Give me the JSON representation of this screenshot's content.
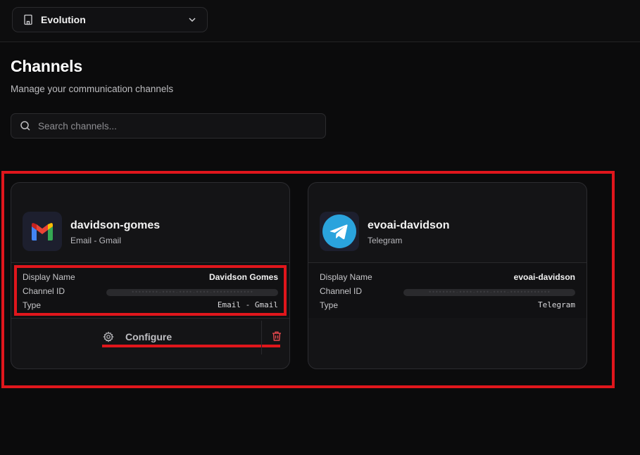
{
  "org_selector": {
    "name": "Evolution"
  },
  "page": {
    "title": "Channels",
    "subtitle": "Manage your communication channels"
  },
  "search": {
    "placeholder": "Search channels..."
  },
  "labels": {
    "display_name": "Display Name",
    "channel_id": "Channel ID",
    "type": "Type",
    "configure": "Configure"
  },
  "channels": [
    {
      "name": "davidson-gomes",
      "type_label": "Email - Gmail",
      "display_name": "Davidson Gomes",
      "channel_id": "••••••••-••••-••••-••••-••••••••••••",
      "type": "Email - Gmail",
      "icon": "gmail-icon"
    },
    {
      "name": "evoai-davidson",
      "type_label": "Telegram",
      "display_name": "evoai-davidson",
      "channel_id": "••••••••-••••-••••-••••-••••••••••••",
      "type": "Telegram",
      "icon": "telegram-icon"
    }
  ],
  "colors": {
    "highlight": "#e0161c",
    "background": "#0b0b0c",
    "card": "#141416",
    "telegram": "#2aa3dd",
    "danger": "#e5484d"
  }
}
